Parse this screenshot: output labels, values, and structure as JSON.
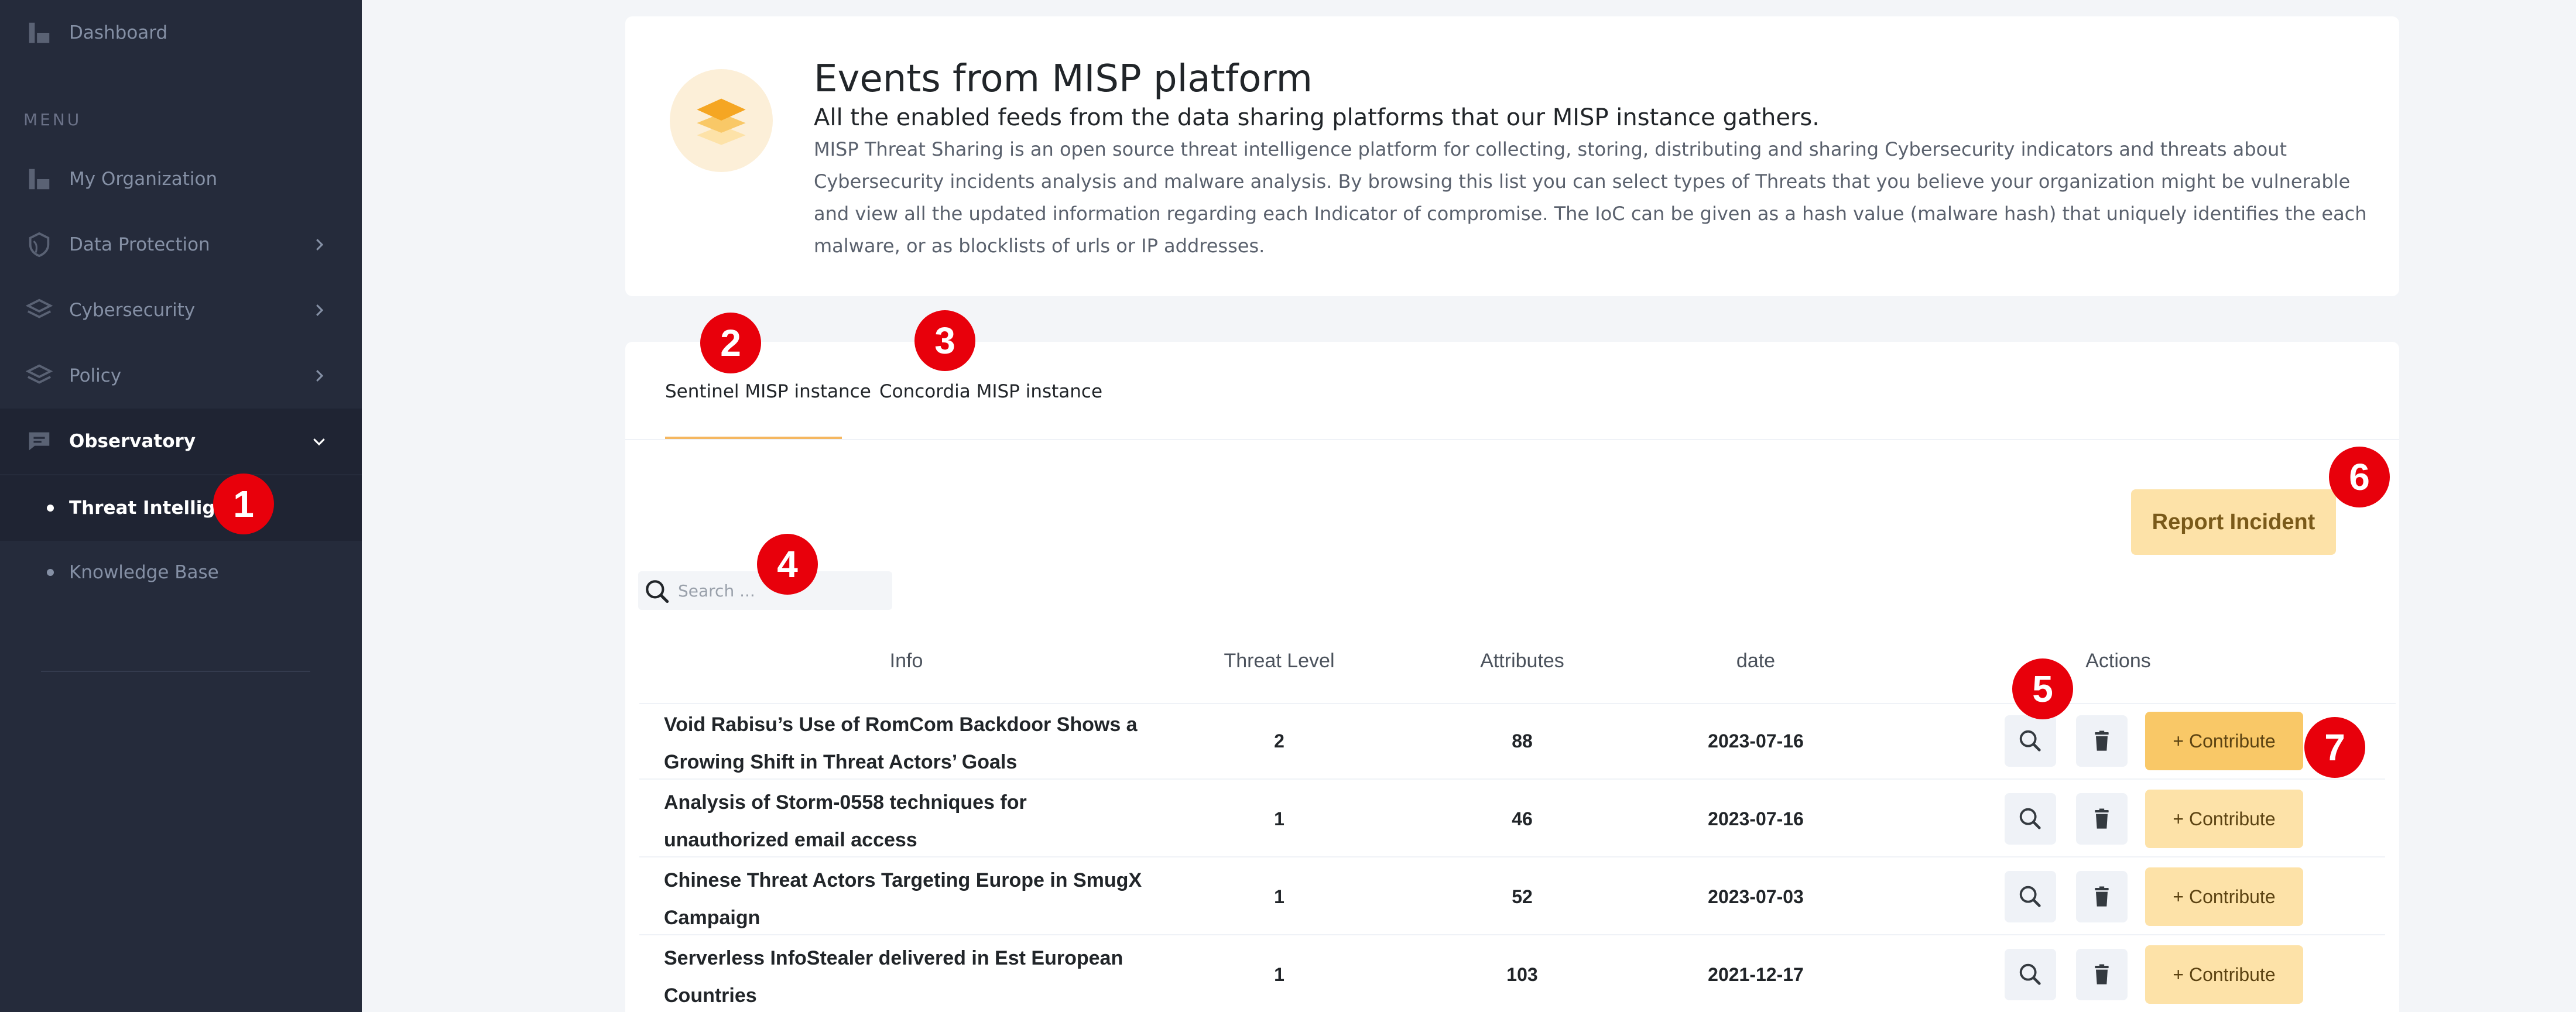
{
  "sidebar": {
    "dashboard": "Dashboard",
    "menu_title": "MENU",
    "items": [
      {
        "label": "My Organization"
      },
      {
        "label": "Data Protection"
      },
      {
        "label": "Cybersecurity"
      },
      {
        "label": "Policy"
      },
      {
        "label": "Observatory"
      }
    ],
    "subitems": [
      {
        "label": "Threat Intelligence",
        "active": true
      },
      {
        "label": "Knowledge Base",
        "active": false
      }
    ]
  },
  "header": {
    "title": "Events from MISP platform",
    "subtitle": "All the enabled feeds from the data sharing platforms that our MISP instance gathers.",
    "description": "MISP Threat Sharing is an open source threat intelligence platform for collecting, storing, distributing and sharing Cybersecurity indicators and threats about Cybersecurity incidents analysis and malware analysis. By browsing this list you can select types of Threats that you believe your organization might be vulnerable and view all the updated information regarding each Indicator of compromise. The IoC can be given as a hash value (malware hash) that uniquely identifies the each malware, or as blocklists of urls or IP addresses."
  },
  "tabs": [
    {
      "label": "Sentinel MISP instance",
      "active": true
    },
    {
      "label": "Concordia MISP instance",
      "active": false
    }
  ],
  "report_button": "Report Incident",
  "search": {
    "placeholder": "Search ..."
  },
  "table": {
    "headers": {
      "info": "Info",
      "threat_level": "Threat Level",
      "attributes": "Attributes",
      "date": "date",
      "actions": "Actions"
    },
    "rows": [
      {
        "info": "Void Rabisu’s Use of RomCom Backdoor Shows a Growing Shift in Threat Actors’ Goals",
        "threat_level": "2",
        "attributes": "88",
        "date": "2023-07-16"
      },
      {
        "info": "Analysis of Storm-0558 techniques for unauthorized email access",
        "threat_level": "1",
        "attributes": "46",
        "date": "2023-07-16"
      },
      {
        "info": "Chinese Threat Actors Targeting Europe in SmugX Campaign",
        "threat_level": "1",
        "attributes": "52",
        "date": "2023-07-03"
      },
      {
        "info": "Serverless InfoStealer delivered in Est European Countries",
        "threat_level": "1",
        "attributes": "103",
        "date": "2021-12-17"
      }
    ],
    "contribute_label": "+ Contribute"
  },
  "callouts": [
    "1",
    "2",
    "3",
    "4",
    "5",
    "6",
    "7"
  ],
  "colors": {
    "sidebar_bg": "#252b3b",
    "accent": "#f9c867",
    "accent_light": "#fde2a8",
    "callout": "#e8000b"
  },
  "icons": {
    "dashboard": "dashboard-icon",
    "organization": "organization-icon",
    "data_protection": "shield-icon",
    "cybersecurity": "layers-icon",
    "policy": "layers-icon",
    "observatory": "chat-icon",
    "search": "search-icon",
    "view": "search-icon",
    "delete": "trash-icon",
    "logo": "layers-icon"
  }
}
